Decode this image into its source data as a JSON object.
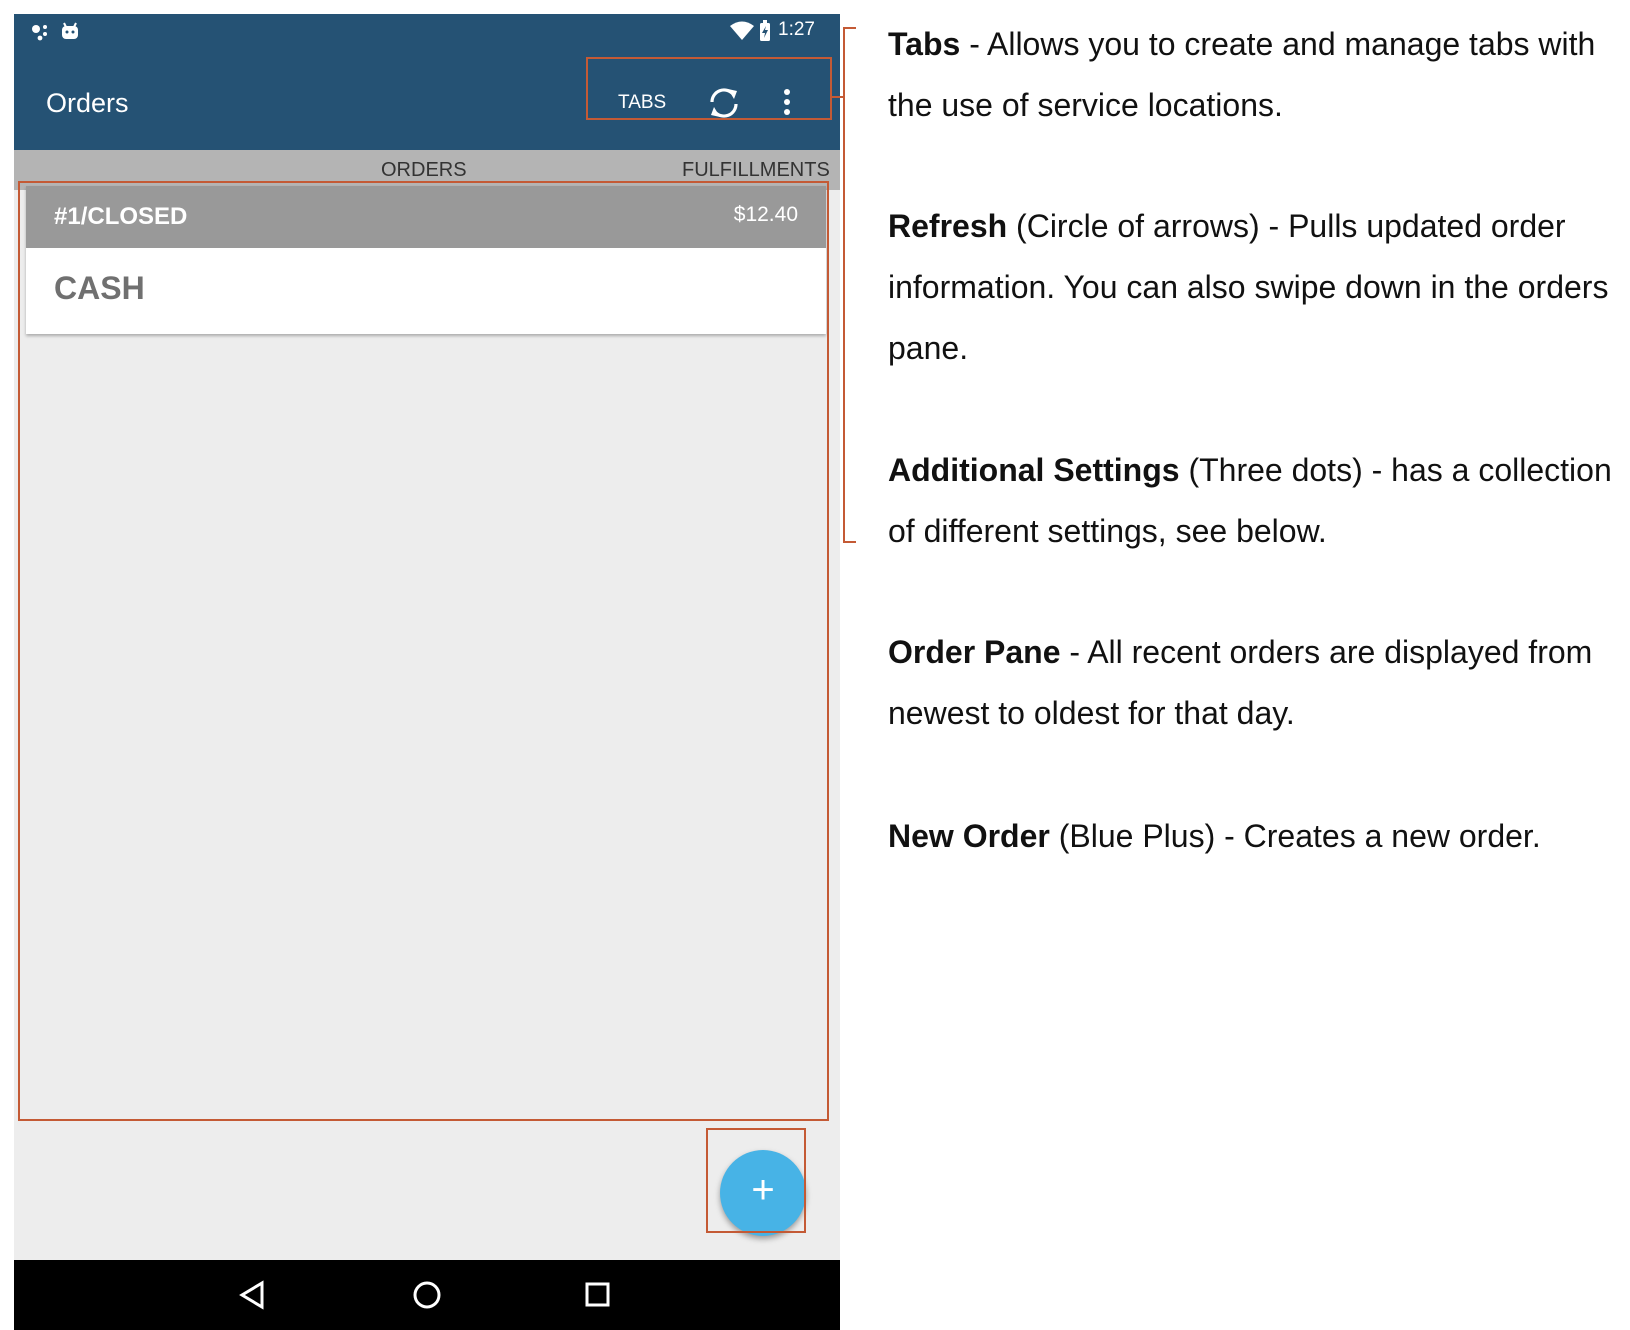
{
  "status_bar": {
    "time": "1:27"
  },
  "app_bar": {
    "title": "Orders",
    "tabs_button": "TABS"
  },
  "tabs": [
    {
      "label": "ORDERS"
    },
    {
      "label": "FULFILLMENTS"
    }
  ],
  "order": {
    "header": "#1/CLOSED",
    "amount": "$12.40",
    "payment": "CASH"
  },
  "fab": {
    "label": "+"
  },
  "annotations": [
    {
      "term": "Tabs",
      "text": " - Allows you to create and manage tabs with the use of service locations."
    },
    {
      "term": "Refresh",
      "text": " (Circle of arrows) - Pulls updated order information. You can also swipe down in the orders pane."
    },
    {
      "term": "Additional Settings",
      "text": " (Three dots) - has a collection of different settings, see below."
    },
    {
      "term": "Order Pane",
      "text": " - All recent orders are displayed from newest to oldest for that day."
    },
    {
      "term": "New Order",
      "text": " (Blue Plus) - Creates a new order."
    }
  ],
  "colors": {
    "app_bar": "#255274",
    "highlight": "#c45a35",
    "fab": "#47b3e6"
  },
  "icons": [
    "wifi-icon",
    "battery-icon",
    "refresh-icon",
    "more-vert-icon",
    "back-icon",
    "home-icon",
    "recents-icon"
  ]
}
